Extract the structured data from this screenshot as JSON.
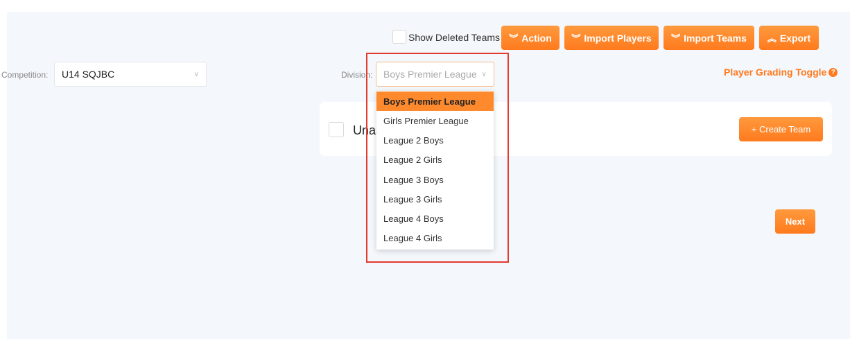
{
  "toolbar": {
    "show_deleted_label": "Show Deleted Teams",
    "action_label": "Action",
    "import_players_label": "Import Players",
    "import_teams_label": "Import Teams",
    "export_label": "Export"
  },
  "filters": {
    "competition_label": "Competition:",
    "competition_value": "U14 SQJBC",
    "division_label": "Division:",
    "division_value": "Boys Premier League",
    "player_grading_label": "Player Grading Toggle"
  },
  "division_dropdown": {
    "options": [
      "Boys Premier League",
      "Girls Premier League",
      "League 2 Boys",
      "League 2 Girls",
      "League 3 Boys",
      "League 3 Girls",
      "League 4 Boys",
      "League 4 Girls"
    ],
    "selected": "Boys Premier League"
  },
  "team_card": {
    "title": "Unassigned",
    "create_team_label": "+ Create Team"
  },
  "next_label": "Next",
  "colors": {
    "accent": "#ff7a1e",
    "highlight": "#e53a2f",
    "panel_bg": "#f4f7fb"
  },
  "icons": {
    "chevron_double_down": "≫",
    "chevron_double_up": "≪",
    "help": "?"
  }
}
